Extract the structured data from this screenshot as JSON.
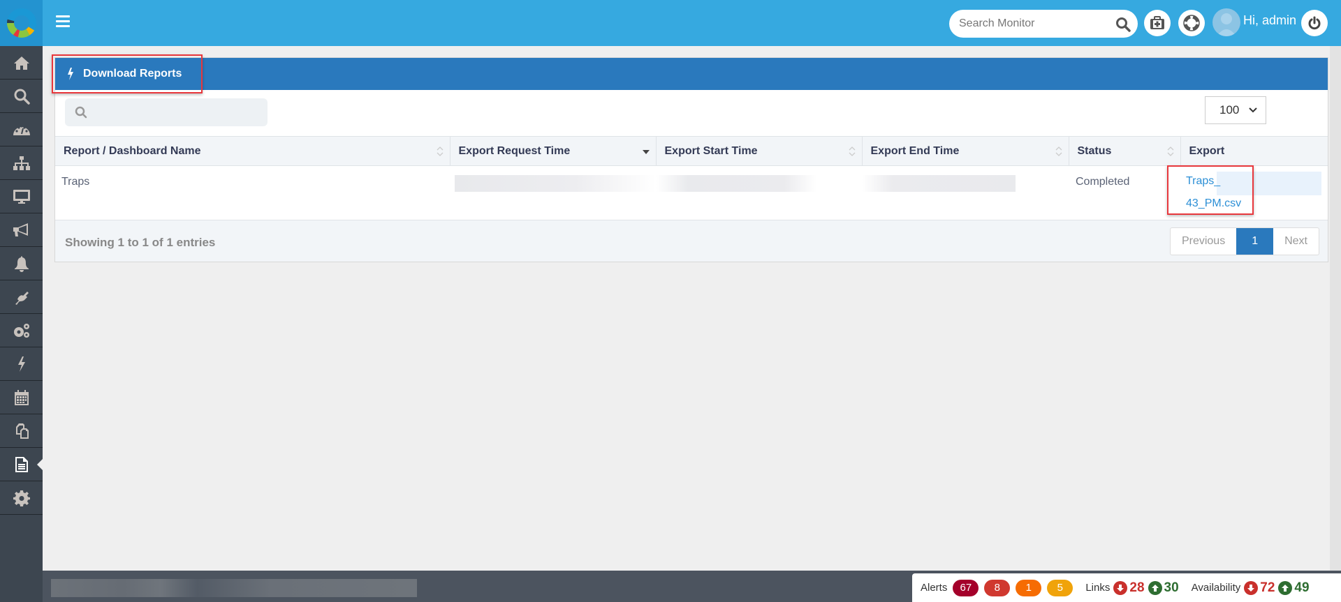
{
  "header": {
    "search_placeholder": "Search Monitor",
    "greeting": "Hi, admin",
    "icons": [
      "menu-icon",
      "search-icon",
      "medkit-icon",
      "life-ring-icon",
      "avatar",
      "power-icon"
    ]
  },
  "sidebar": {
    "items": [
      {
        "name": "home",
        "icon": "home-icon"
      },
      {
        "name": "search",
        "icon": "search-icon"
      },
      {
        "name": "dashboard",
        "icon": "dashboard-icon"
      },
      {
        "name": "topology",
        "icon": "sitemap-icon"
      },
      {
        "name": "monitors",
        "icon": "desktop-icon"
      },
      {
        "name": "announcements",
        "icon": "bullhorn-icon"
      },
      {
        "name": "alerts",
        "icon": "bell-icon"
      },
      {
        "name": "integrations",
        "icon": "plug-icon"
      },
      {
        "name": "admin",
        "icon": "cogs-icon"
      },
      {
        "name": "actions",
        "icon": "bolt-icon"
      },
      {
        "name": "schedule",
        "icon": "calendar-icon"
      },
      {
        "name": "copy",
        "icon": "copy-icon"
      },
      {
        "name": "reports",
        "icon": "file-text-icon",
        "active": true
      },
      {
        "name": "settings",
        "icon": "gear-icon"
      }
    ]
  },
  "panel": {
    "title": "Download Reports",
    "page_length": "100",
    "search_value": "",
    "columns": [
      {
        "label": "Report / Dashboard Name",
        "sort": "none"
      },
      {
        "label": "Export Request Time",
        "sort": "desc"
      },
      {
        "label": "Export Start Time",
        "sort": "none"
      },
      {
        "label": "Export End Time",
        "sort": "none"
      },
      {
        "label": "Status",
        "sort": "none"
      },
      {
        "label": "Export",
        "sort": null
      }
    ],
    "rows": [
      {
        "name": "Traps",
        "request_time": "[redacted]",
        "start_time": "[redacted]",
        "end_time": "[redacted]",
        "status": "Completed",
        "export_line1": "Traps_",
        "export_line2": "43_PM.csv"
      }
    ],
    "info": "Showing 1 to 1 of 1 entries",
    "pagination": {
      "previous": "Previous",
      "current": "1",
      "next": "Next"
    }
  },
  "statusbar": {
    "alerts_label": "Alerts",
    "alerts": [
      {
        "count": "67",
        "color": "#a4002a"
      },
      {
        "count": "8",
        "color": "#d0382f"
      },
      {
        "count": "1",
        "color": "#f66c03"
      },
      {
        "count": "5",
        "color": "#f0a30a"
      }
    ],
    "links_label": "Links",
    "links_down": "28",
    "links_up": "30",
    "availability_label": "Availability",
    "availability_down": "72",
    "availability_up": "49"
  },
  "colors": {
    "topbar": "#36a9e0",
    "panel_header": "#2a79bd",
    "sidebar": "#3d4650",
    "link": "#2c8fd6",
    "highlight": "#e8373c"
  }
}
